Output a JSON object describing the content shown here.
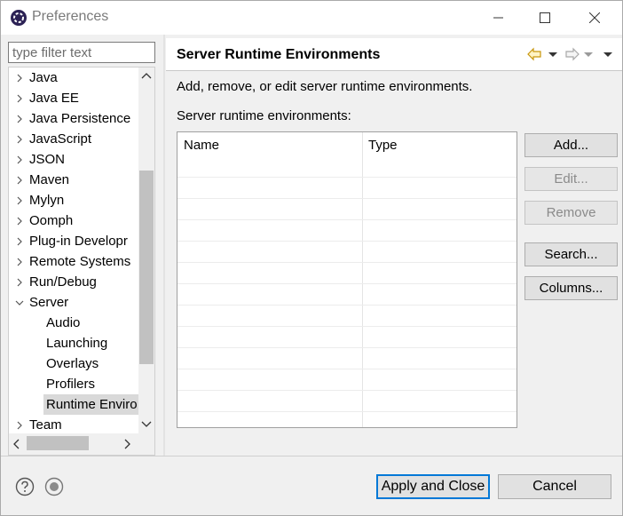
{
  "window": {
    "title": "Preferences"
  },
  "filter": {
    "placeholder": "type filter text"
  },
  "tree": {
    "items": [
      {
        "label": "Java",
        "expanded": false
      },
      {
        "label": "Java EE",
        "expanded": false
      },
      {
        "label": "Java Persistence",
        "expanded": false
      },
      {
        "label": "JavaScript",
        "expanded": false
      },
      {
        "label": "JSON",
        "expanded": false
      },
      {
        "label": "Maven",
        "expanded": false
      },
      {
        "label": "Mylyn",
        "expanded": false
      },
      {
        "label": "Oomph",
        "expanded": false
      },
      {
        "label": "Plug-in Developr",
        "expanded": false
      },
      {
        "label": "Remote Systems",
        "expanded": false
      },
      {
        "label": "Run/Debug",
        "expanded": false
      },
      {
        "label": "Server",
        "expanded": true
      },
      {
        "label": "Audio",
        "child": true
      },
      {
        "label": "Launching",
        "child": true
      },
      {
        "label": "Overlays",
        "child": true
      },
      {
        "label": "Profilers",
        "child": true
      },
      {
        "label": "Runtime Enviro",
        "child": true,
        "selected": true
      },
      {
        "label": "Team",
        "expanded": false
      }
    ]
  },
  "page": {
    "title": "Server Runtime Environments",
    "description": "Add, remove, or edit server runtime environments.",
    "list_label": "Server runtime environments:",
    "table": {
      "columns": [
        "Name",
        "Type"
      ],
      "rows": []
    },
    "buttons": {
      "add": "Add...",
      "edit": "Edit...",
      "remove": "Remove",
      "search": "Search...",
      "columns": "Columns..."
    }
  },
  "footer": {
    "apply_close": "Apply and Close",
    "cancel": "Cancel"
  },
  "colors": {
    "accent": "#0078d7",
    "nav_arrow": "#d4a017"
  }
}
